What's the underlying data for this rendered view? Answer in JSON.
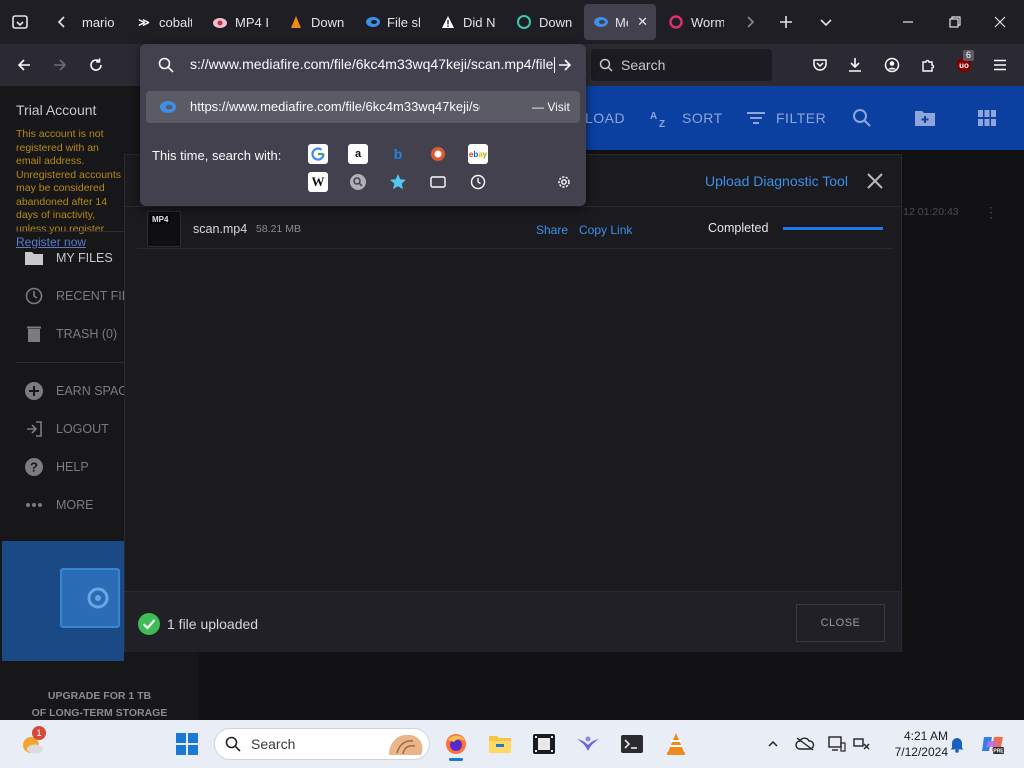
{
  "tabs": [
    {
      "title": "mario",
      "active": false
    },
    {
      "title": "cobalt",
      "active": false
    },
    {
      "title": "MP4 I",
      "active": false
    },
    {
      "title": "Down",
      "active": false
    },
    {
      "title": "File sh",
      "active": false
    },
    {
      "title": "Did N",
      "active": false
    },
    {
      "title": "Down",
      "active": false
    },
    {
      "title": "Me",
      "active": true
    },
    {
      "title": "Worm",
      "active": false
    }
  ],
  "urlbar": {
    "typed_value": "s://www.mediafire.com/file/6kc4m33wq47keji/scan.mp4/file",
    "suggestion_url": "https://www.mediafire.com/file/6kc4m33wq47keji/scan.mp4/file",
    "suggestion_action": "— Visit",
    "this_time_label": "This time, search with:"
  },
  "toolbar_search_placeholder": "Search",
  "extension_badge": "6",
  "sidebar": {
    "trial_title": "Trial Account",
    "trial_message": "This account is not registered with an email address. Unregistered accounts may be considered abandoned after 14 days of inactivity, unless you register.",
    "register_link": "Register now",
    "items": [
      {
        "label": "MY FILES",
        "icon": "folder-icon"
      },
      {
        "label": "RECENT FILES",
        "icon": "clock-icon"
      },
      {
        "label": "TRASH (0)",
        "icon": "trash-icon"
      },
      {
        "label": "EARN SPACE",
        "icon": "plus-circle-icon"
      },
      {
        "label": "LOGOUT",
        "icon": "logout-icon"
      },
      {
        "label": "HELP",
        "icon": "help-icon"
      },
      {
        "label": "MORE",
        "icon": "more-icon"
      }
    ],
    "promo_line1": "UPGRADE FOR 1 TB",
    "promo_line2": "OF LONG-TERM STORAGE"
  },
  "toolbar": {
    "upload": "LOAD",
    "sort": "SORT",
    "filter": "FILTER"
  },
  "file_list": {
    "date": "07-12 01:20:43"
  },
  "modal": {
    "diagnostic_link": "Upload Diagnostic Tool",
    "file": {
      "type_label": "MP4",
      "name": "scan.mp4",
      "size": "58.21 MB",
      "share": "Share",
      "copy_link": "Copy Link",
      "status": "Completed",
      "progress": 1.0
    },
    "footer_text": "1 file uploaded",
    "close_button": "CLOSE"
  },
  "taskbar": {
    "search_placeholder": "Search",
    "weather_badge": "1",
    "time": "4:21 AM",
    "date": "7/12/2024"
  },
  "colors": {
    "accent_blue": "#3d8fe8",
    "toolbar_blue": "#0b3fa0",
    "success_green": "#3fbc56",
    "warning_text": "#b68a13"
  }
}
